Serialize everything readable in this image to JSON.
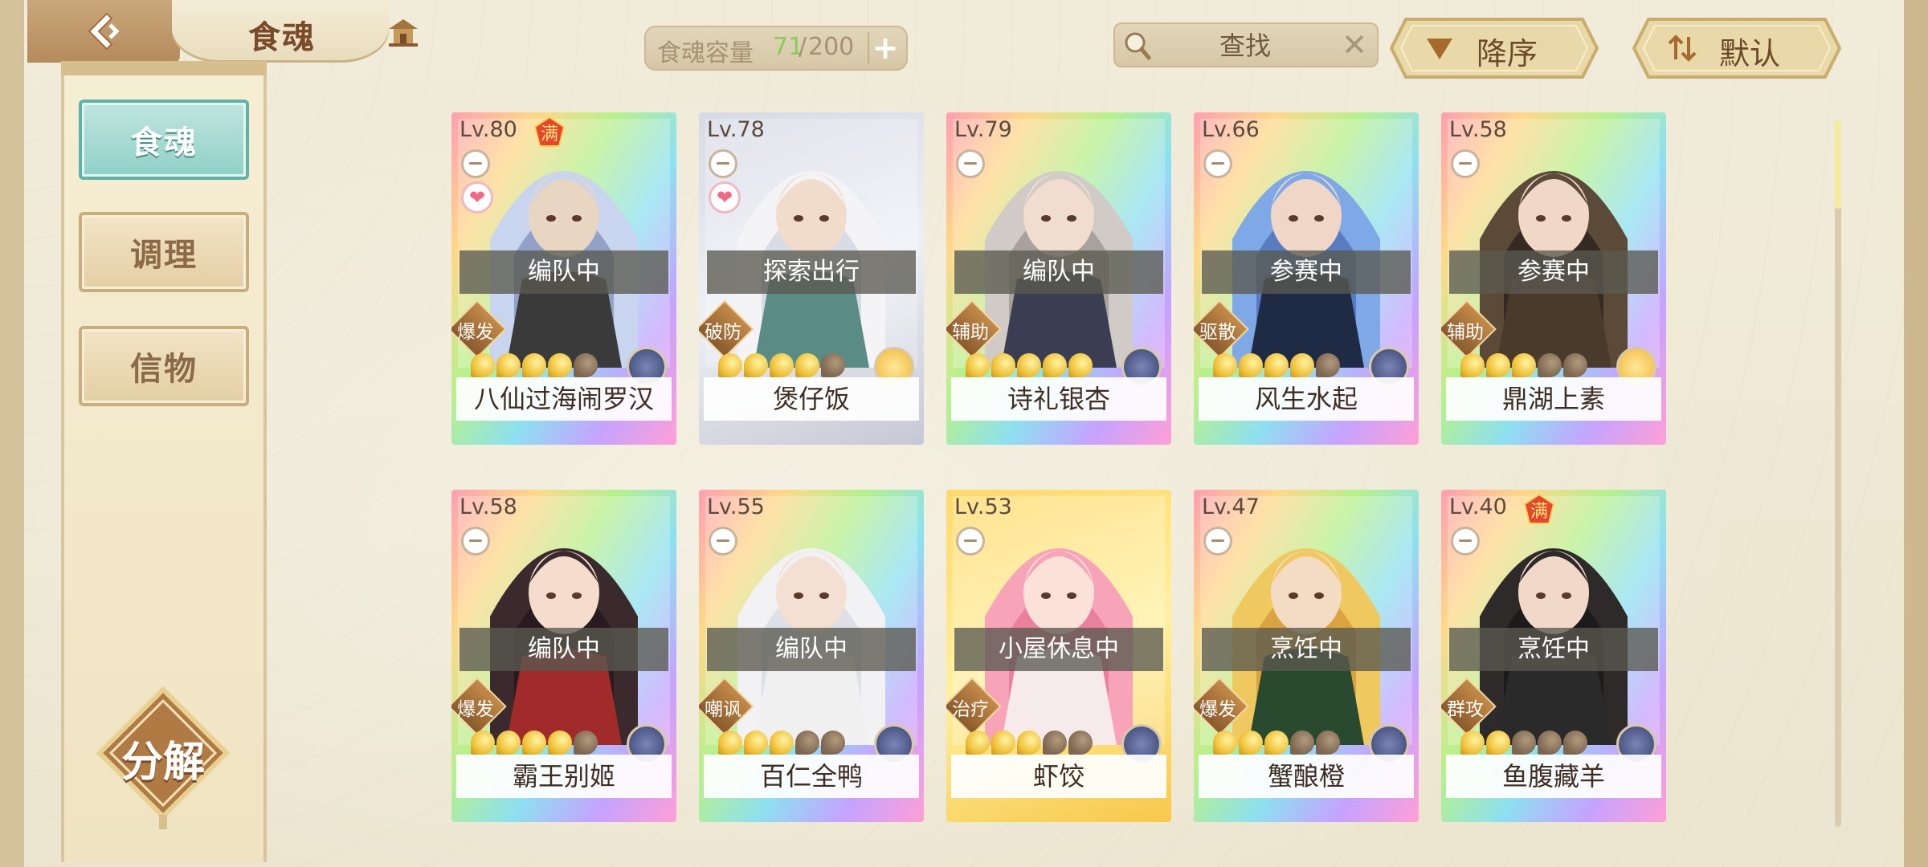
{
  "header": {
    "title": "食魂",
    "capacity": {
      "label": "食魂容量",
      "current": "71",
      "sep": "/",
      "max": "200",
      "add_symbol": "+"
    },
    "search": {
      "placeholder": "查找",
      "clear_symbol": "✕"
    },
    "sort_order_label": "降序",
    "sort_mode_label": "默认"
  },
  "sidebar": {
    "items": [
      {
        "label": "食魂",
        "active": true
      },
      {
        "label": "调理",
        "active": false
      },
      {
        "label": "信物",
        "active": false
      }
    ],
    "decompose_label": "分解"
  },
  "colors": {
    "accent_teal": "#8fd0c6",
    "capacity_current": "#8acb5c",
    "status_bar": "#5a5a50"
  },
  "cards": [
    {
      "level": "Lv.80",
      "max_mark": "满",
      "favorite": true,
      "status": "编队中",
      "role": "爆发",
      "stars_filled": 4,
      "element": "dark",
      "name": "八仙过海闹罗汉",
      "frame": "rainbow",
      "portrait": "pale-blue-hair"
    },
    {
      "level": "Lv.78",
      "max_mark": "",
      "favorite": true,
      "status": "探索出行",
      "role": "破防",
      "stars_filled": 4,
      "element": "light",
      "name": "煲仔饭",
      "frame": "silver",
      "portrait": "white-hair"
    },
    {
      "level": "Lv.79",
      "max_mark": "",
      "favorite": false,
      "status": "编队中",
      "role": "辅助",
      "stars_filled": 5,
      "element": "dark",
      "name": "诗礼银杏",
      "frame": "rainbow",
      "portrait": "grey-hair"
    },
    {
      "level": "Lv.66",
      "max_mark": "",
      "favorite": false,
      "status": "参赛中",
      "role": "驱散",
      "stars_filled": 4,
      "element": "dark",
      "name": "风生水起",
      "frame": "rainbow",
      "portrait": "blue-hair"
    },
    {
      "level": "Lv.58",
      "max_mark": "",
      "favorite": false,
      "status": "参赛中",
      "role": "辅助",
      "stars_filled": 3,
      "element": "light",
      "name": "鼎湖上素",
      "frame": "rainbow",
      "portrait": "straw-hat"
    },
    {
      "level": "Lv.58",
      "max_mark": "",
      "favorite": false,
      "status": "编队中",
      "role": "爆发",
      "stars_filled": 4,
      "element": "dark",
      "name": "霸王别姬",
      "frame": "rainbow",
      "portrait": "opera-black-hair"
    },
    {
      "level": "Lv.55",
      "max_mark": "",
      "favorite": false,
      "status": "编队中",
      "role": "嘲讽",
      "stars_filled": 3,
      "element": "dark",
      "name": "百仁全鸭",
      "frame": "rainbow",
      "portrait": "white-long-hair"
    },
    {
      "level": "Lv.53",
      "max_mark": "",
      "favorite": false,
      "status": "小屋休息中",
      "role": "治疗",
      "stars_filled": 3,
      "element": "dark",
      "name": "虾饺",
      "frame": "gold",
      "portrait": "pink-hair"
    },
    {
      "level": "Lv.47",
      "max_mark": "",
      "favorite": false,
      "status": "烹饪中",
      "role": "爆发",
      "stars_filled": 3,
      "element": "dark",
      "name": "蟹酿橙",
      "frame": "rainbow",
      "portrait": "blond-goggles"
    },
    {
      "level": "Lv.40",
      "max_mark": "满",
      "favorite": false,
      "status": "烹饪中",
      "role": "群攻",
      "stars_filled": 2,
      "element": "dark",
      "name": "鱼腹藏羊",
      "frame": "rainbow",
      "portrait": "dark-hair-horn"
    }
  ],
  "scroll": {
    "position": 0.0
  }
}
